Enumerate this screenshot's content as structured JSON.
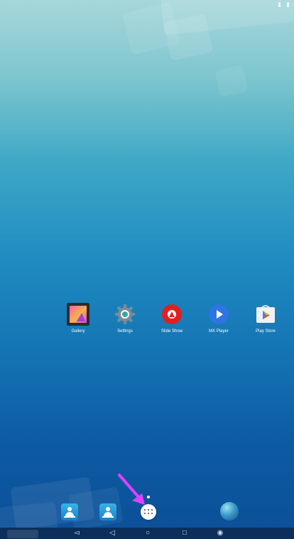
{
  "apps": [
    {
      "label": "Gallery",
      "icon": "gallery-icon"
    },
    {
      "label": "Settings",
      "icon": "settings-icon"
    },
    {
      "label": "Slide Show",
      "icon": "slideshow-icon"
    },
    {
      "label": "MX Player",
      "icon": "mx-player-icon"
    },
    {
      "label": "Play Store",
      "icon": "play-store-icon"
    }
  ],
  "dock": [
    {
      "icon": "contacts-icon"
    },
    {
      "icon": "contacts-icon"
    },
    {
      "icon": "all-apps-icon"
    },
    {
      "icon": "browser-globe-icon"
    }
  ],
  "nav": [
    "volume-down-icon",
    "back-icon",
    "home-icon",
    "recents-icon",
    "volume-up-icon"
  ],
  "colors": {
    "highlight_arrow": "#e040fb",
    "slideshow": "#e02020",
    "mxplayer": "#2f74e3"
  }
}
